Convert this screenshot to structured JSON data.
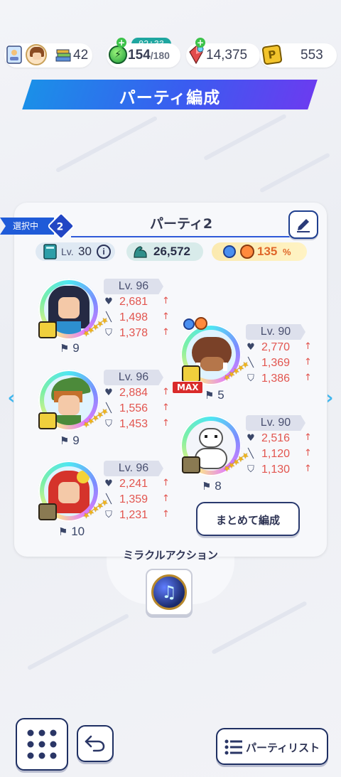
{
  "topbar": {
    "rank_value": "42",
    "stamina_timer": "02:33",
    "stamina_current": "154",
    "stamina_max": "/180",
    "gems": "14,375",
    "coins": "553"
  },
  "title": "パーティ編成",
  "party": {
    "selected_label": "選択中",
    "selected_number": "2",
    "name": "パーティ2",
    "level_prefix": "Lv.",
    "level_value": "30",
    "power": "26,572",
    "bonus": "135",
    "bonus_unit": "%"
  },
  "characters": [
    {
      "level": "Lv. 96",
      "hp": "2,681",
      "atk": "1,498",
      "def": "1,378",
      "count": "9"
    },
    {
      "level": "Lv. 96",
      "hp": "2,884",
      "atk": "1,556",
      "def": "1,453",
      "count": "9"
    },
    {
      "level": "Lv. 96",
      "hp": "2,241",
      "atk": "1,359",
      "def": "1,231",
      "count": "10"
    },
    {
      "level": "Lv. 90",
      "hp": "2,770",
      "atk": "1,369",
      "def": "1,386",
      "count": "5",
      "max_badge": "MAX"
    },
    {
      "level": "Lv. 90",
      "hp": "2,516",
      "atk": "1,120",
      "def": "1,130",
      "count": "8"
    }
  ],
  "bulk_button": "まとめて編成",
  "miracle_action_label": "ミラクルアクション",
  "bottom": {
    "party_list_label": "パーティリスト"
  },
  "colors": {
    "accent_blue": "#1f5bd8",
    "stat_red": "#e2554f",
    "gold": "#f2b418"
  }
}
